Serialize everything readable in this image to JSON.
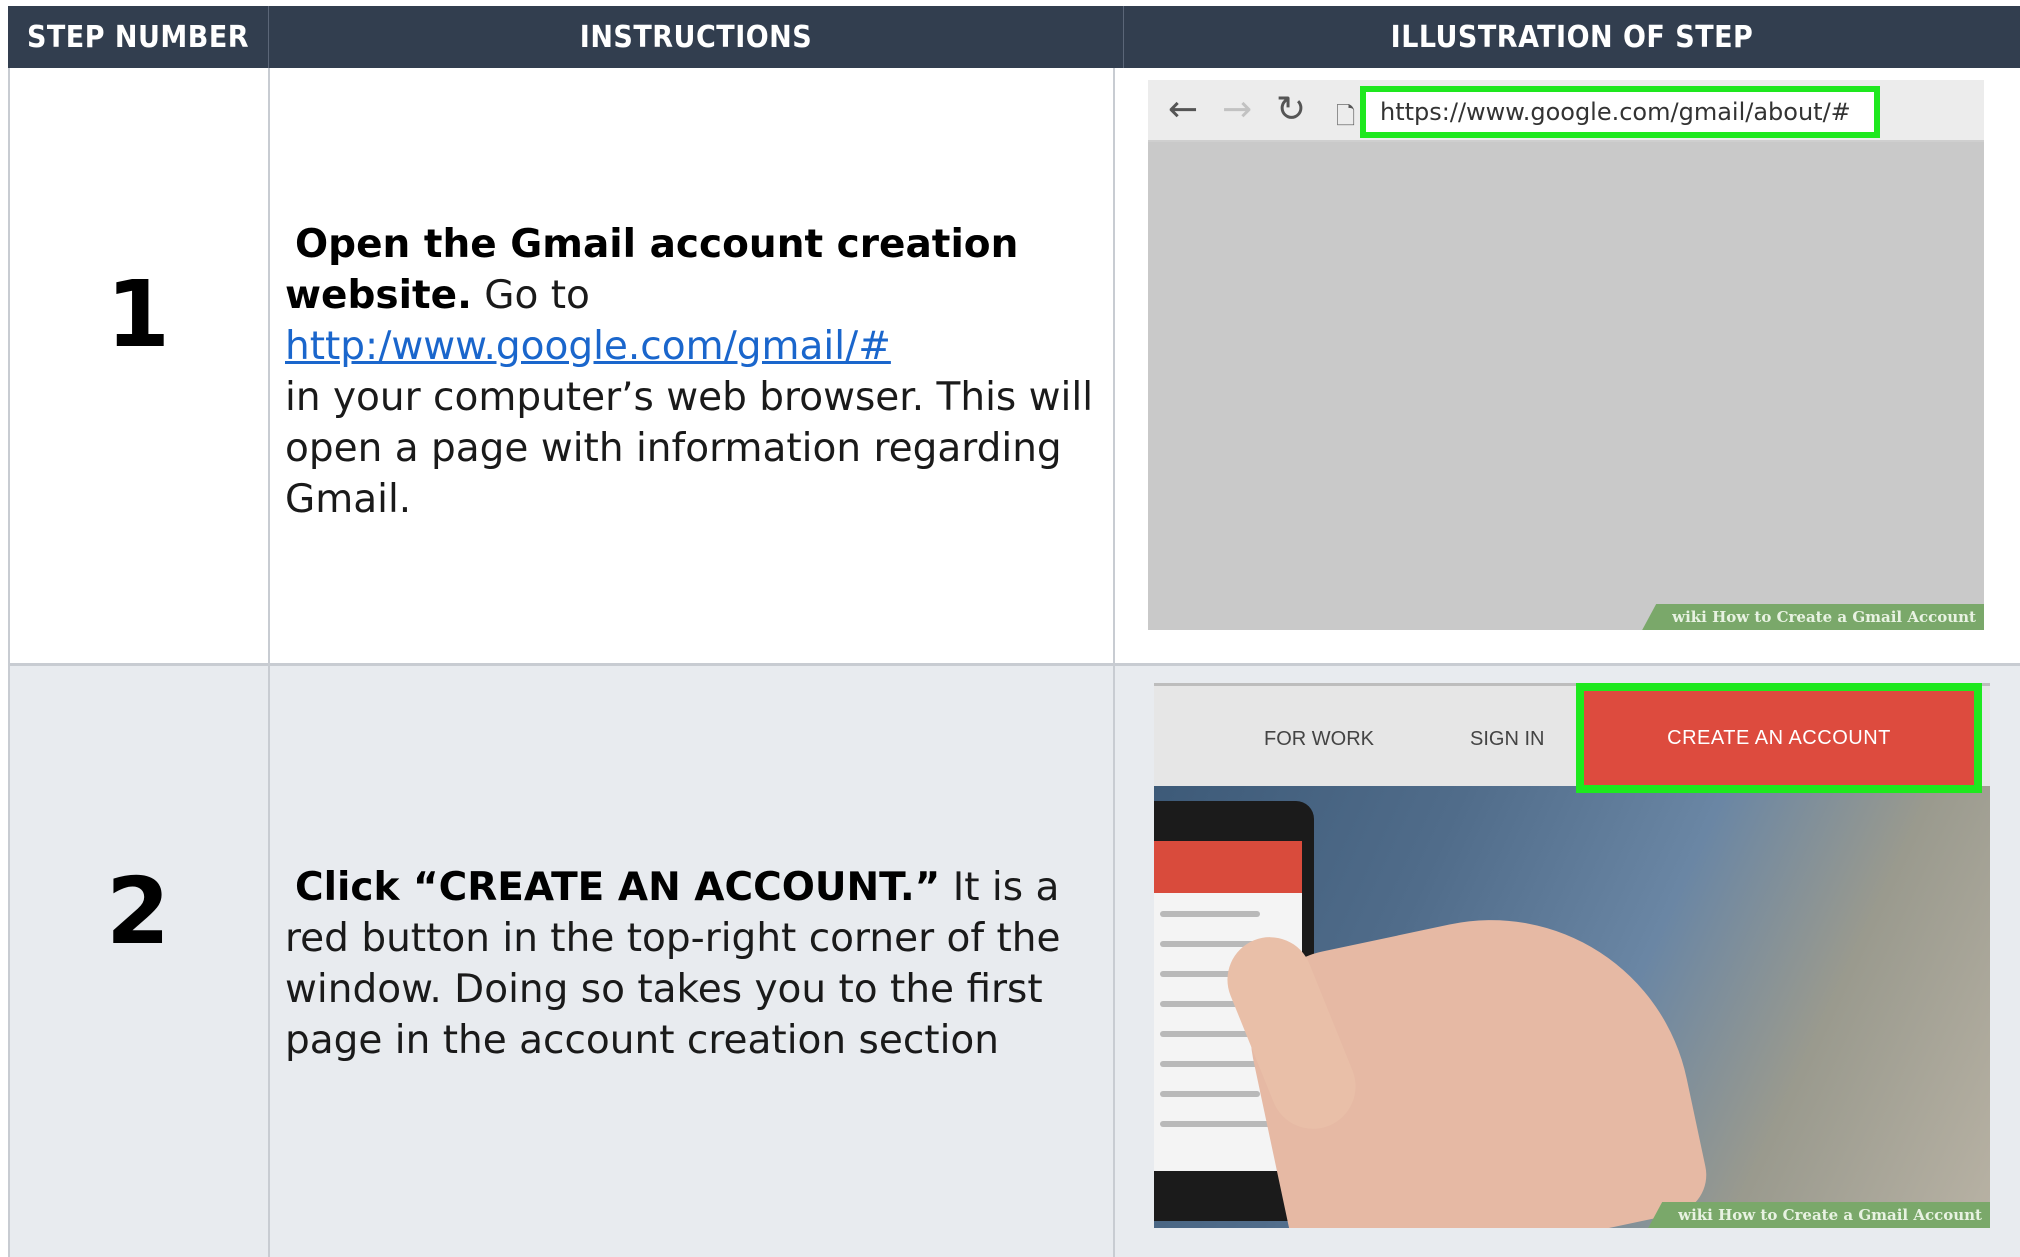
{
  "header": {
    "col1": "STEP NUMBER",
    "col2": "INSTRUCTIONS",
    "col3": "ILLUSTRATION OF STEP"
  },
  "steps": [
    {
      "number": "1",
      "bold_lead": "Open the Gmail account creation website.",
      "text_before_link": " Go to",
      "link": "http:/www.google.com/gmail/#",
      "text_after_link": "in your computer’s web browser. This will open a page with information regarding Gmail.",
      "illustration": {
        "url": "https://www.google.com/gmail/about/#",
        "watermark_wiki": "wiki",
        "watermark_text": "How to Create a Gmail Account"
      }
    },
    {
      "number": "2",
      "bold_lead": "Click “CREATE AN ACCOUNT.”",
      "text": " It is a red button in the top-right corner of the window. Doing so takes you to the first page in the account creation section",
      "illustration": {
        "nav_for_work": "FOR WORK",
        "nav_sign_in": "SIGN IN",
        "create_button": "CREATE AN ACCOUNT",
        "watermark_wiki": "wiki",
        "watermark_text": "How to Create a Gmail Account"
      }
    }
  ],
  "colors": {
    "header_bg": "#323e4f",
    "highlight": "#1ee81e",
    "create_red": "#dd4b3e",
    "link": "#1a66cc"
  },
  "icons": [
    "back-arrow-icon",
    "forward-arrow-icon",
    "reload-icon",
    "page-icon"
  ]
}
